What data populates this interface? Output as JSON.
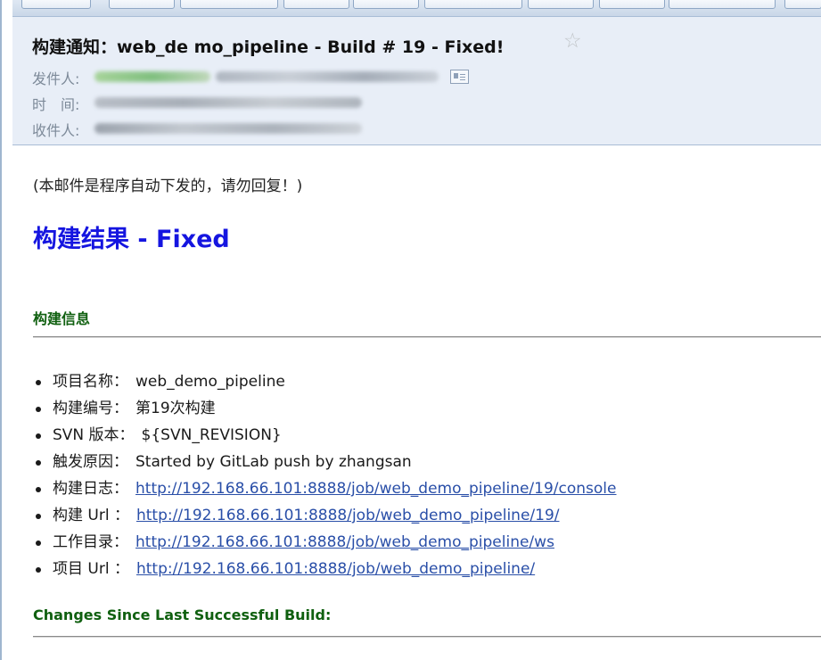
{
  "email": {
    "subject": "构建通知：web_de mo_pipeline - Build # 19 - Fixed!",
    "from_label": "发件人:",
    "time_label": "时　间:",
    "to_label": "收件人:"
  },
  "content": {
    "notice": "(本邮件是程序自动下发的，请勿回复！)",
    "result_title": "构建结果 - Fixed",
    "build_info_title": "构建信息",
    "items": [
      {
        "label": "项目名称：",
        "value": "web_demo_pipeline"
      },
      {
        "label": "构建编号：",
        "value": "第19次构建"
      },
      {
        "label": "SVN 版本：",
        "value": "${SVN_REVISION}"
      },
      {
        "label": "触发原因：",
        "value": "Started by GitLab push by zhangsan"
      },
      {
        "label": "构建日志：",
        "link": "http://192.168.66.101:8888/job/web_demo_pipeline/19/console"
      },
      {
        "label": "构建  Url ：",
        "link": "http://192.168.66.101:8888/job/web_demo_pipeline/19/"
      },
      {
        "label": "工作目录：",
        "link": "http://192.168.66.101:8888/job/web_demo_pipeline/ws"
      },
      {
        "label": "项目  Url ：",
        "link": "http://192.168.66.101:8888/job/web_demo_pipeline/"
      }
    ],
    "changes_title": "Changes Since Last Successful Build:"
  },
  "colors": {
    "result_title": "#1515e0",
    "section_title": "#106010",
    "link": "#2a4fa8",
    "header_bg": "#e8eef7"
  },
  "icons": [
    "star-icon",
    "contact-card-icon"
  ]
}
